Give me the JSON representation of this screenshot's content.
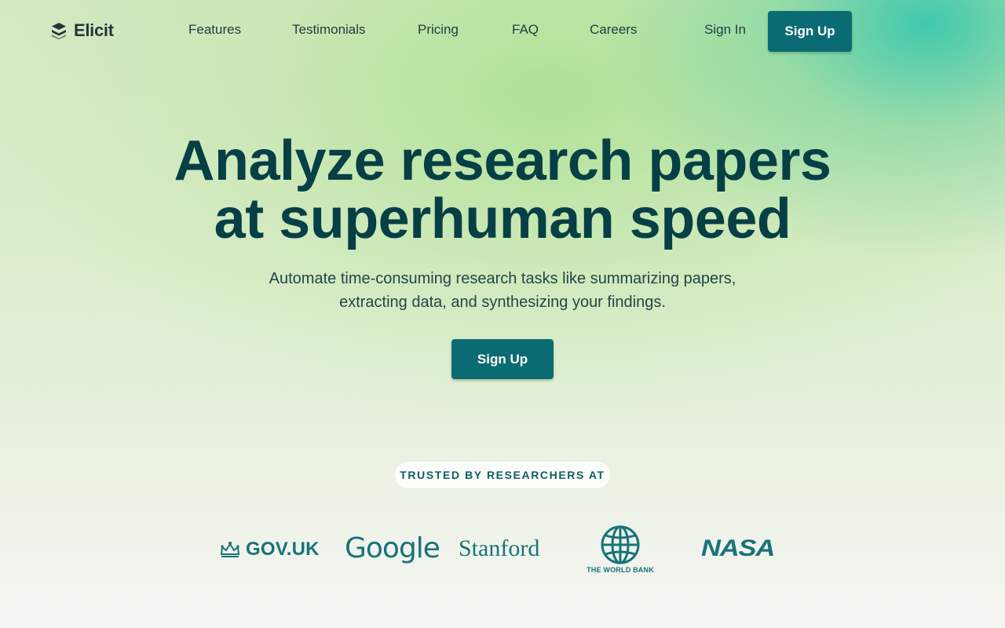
{
  "brand": {
    "name": "Elicit",
    "icon": "stacked-layers-icon",
    "primary_color": "#0b6b72",
    "heading_color": "#063f45"
  },
  "nav": {
    "links": [
      {
        "label": "Features"
      },
      {
        "label": "Testimonials"
      },
      {
        "label": "Pricing"
      },
      {
        "label": "FAQ"
      },
      {
        "label": "Careers"
      }
    ],
    "sign_in": "Sign In",
    "sign_up": "Sign Up"
  },
  "hero": {
    "title_line1": "Analyze research papers",
    "title_line2": "at superhuman speed",
    "subtitle_line1": "Automate time-consuming research tasks like summarizing papers,",
    "subtitle_line2": "extracting data, and synthesizing your findings.",
    "cta": "Sign Up"
  },
  "trusted": {
    "label": "TRUSTED BY RESEARCHERS AT",
    "organizations": [
      {
        "name": "GOV.UK",
        "icon": "crown-icon"
      },
      {
        "name": "Google"
      },
      {
        "name": "Stanford"
      },
      {
        "name": "THE WORLD BANK",
        "icon": "globe-icon"
      },
      {
        "name": "NASA"
      }
    ]
  }
}
